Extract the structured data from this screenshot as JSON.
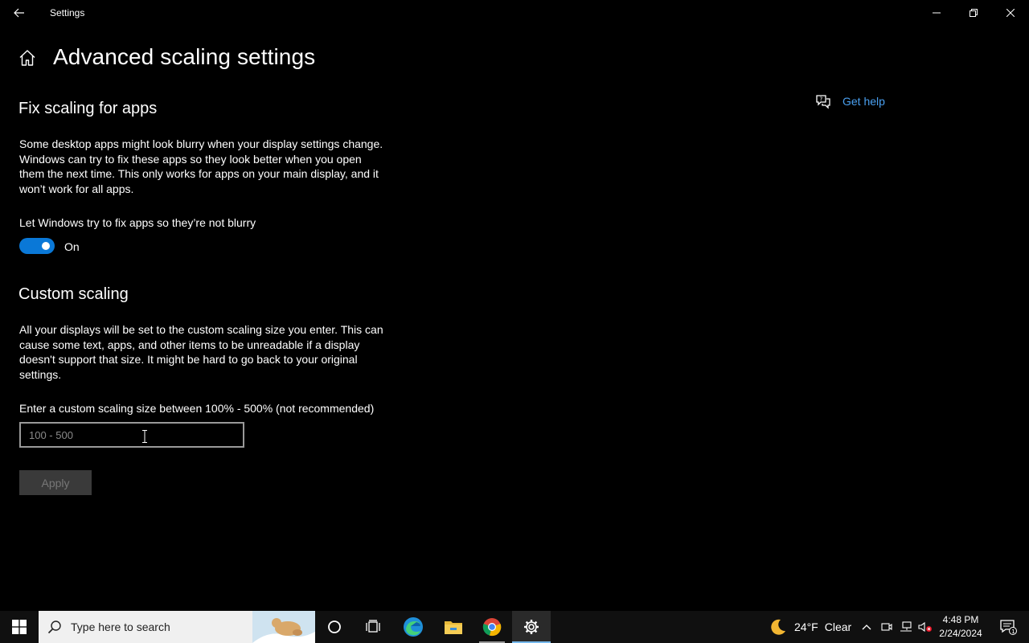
{
  "window": {
    "title": "Settings",
    "back_icon": "back-arrow-icon",
    "controls": [
      "minimize-icon",
      "restore-icon",
      "close-icon"
    ]
  },
  "page": {
    "title": "Advanced scaling settings",
    "home_icon": "home-icon"
  },
  "fix_scaling": {
    "heading": "Fix scaling for apps",
    "description": "Some desktop apps might look blurry when your display settings change. Windows can try to fix these apps so they look better when you open them the next time. This only works for apps on your main display, and it won’t work for all apps.",
    "toggle_label": "Let Windows try to fix apps so they’re not blurry",
    "toggle_state": "On",
    "toggle_on": true
  },
  "custom_scaling": {
    "heading": "Custom scaling",
    "description": "All your displays will be set to the custom scaling size you enter. This can cause some text, apps, and other items to be unreadable if a display doesn't support that size. It might be hard to go back to your original settings.",
    "input_label": "Enter a custom scaling size between 100% - 500% (not recommended)",
    "input_placeholder": "100 - 500",
    "input_value": "",
    "apply_label": "Apply"
  },
  "help": {
    "label": "Get help",
    "icon": "chat-help-icon"
  },
  "taskbar": {
    "search_placeholder": "Type here to search",
    "weather_temp": "24°F",
    "weather_condition": "Clear",
    "time": "4:48 PM",
    "date": "2/24/2024",
    "notification_count": "1"
  },
  "colors": {
    "accent": "#0a78d7",
    "link": "#4aa0f0",
    "background": "#000000"
  }
}
